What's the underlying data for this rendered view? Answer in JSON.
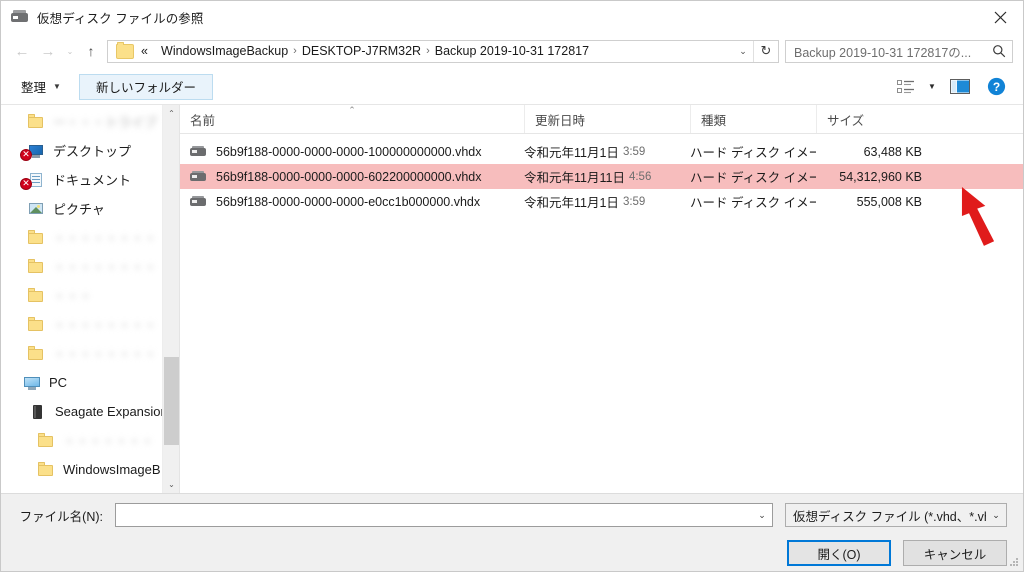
{
  "window": {
    "title": "仮想ディスク ファイルの参照",
    "title_icon": "hard-disk-icon",
    "close_label": "✕"
  },
  "nav": {
    "back_label": "←",
    "forward_label": "→",
    "history_caret": "⌄",
    "up_label": "↑",
    "breadcrumb_prefix": "«",
    "breadcrumbs": [
      "WindowsImageBackup",
      "DESKTOP-J7RM32R",
      "Backup 2019-10-31 172817"
    ],
    "separator": "›",
    "address_caret": "⌄",
    "refresh_label": "↻"
  },
  "search": {
    "placeholder": "Backup 2019-10-31 172817の...",
    "icon": "search-icon"
  },
  "toolbar": {
    "organize_label": "整理",
    "organize_caret": "▼",
    "new_folder_label": "新しいフォルダー",
    "view_caret": "▼",
    "view_icon": "list-view-icon",
    "preview_pane_icon": "preview-pane-icon",
    "help_icon": "help-icon",
    "help_label": "?"
  },
  "sidebar": {
    "items": [
      {
        "label": "ー・・・トライブ",
        "icon": "folder-icon",
        "blurred": true,
        "error": false
      },
      {
        "label": "デスクトップ",
        "icon": "desktop-icon",
        "blurred": false,
        "error": true
      },
      {
        "label": "ドキュメント",
        "icon": "document-icon",
        "blurred": false,
        "error": true
      },
      {
        "label": "ピクチャ",
        "icon": "picture-icon",
        "blurred": false,
        "error": false
      },
      {
        "label": "・・・・・・・・・・",
        "icon": "folder-icon",
        "blurred": true,
        "error": false
      },
      {
        "label": "・・・・・・・・・",
        "icon": "folder-icon",
        "blurred": true,
        "error": false
      },
      {
        "label": "・・・",
        "icon": "folder-icon",
        "blurred": true,
        "error": false
      },
      {
        "label": "・・・・・・・・",
        "icon": "folder-icon",
        "blurred": true,
        "error": false
      },
      {
        "label": "・・・・・・・・",
        "icon": "folder-icon",
        "blurred": true,
        "error": false
      },
      {
        "label": "PC",
        "icon": "pc-icon",
        "blurred": false,
        "error": false
      },
      {
        "label": "Seagate Expansion",
        "icon": "drive-icon",
        "blurred": false,
        "error": false
      },
      {
        "label": "・・・・・・・",
        "icon": "folder-icon",
        "blurred": true,
        "error": false
      },
      {
        "label": "WindowsImageB",
        "icon": "folder-icon",
        "blurred": false,
        "error": false
      }
    ],
    "scroll_up": "⌃",
    "scroll_down": "⌄"
  },
  "columns": {
    "name": "名前",
    "date": "更新日時",
    "type": "種類",
    "size": "サイズ",
    "sort_caret": "⌃"
  },
  "files": [
    {
      "name": "56b9f188-0000-0000-0000-100000000000.vhdx",
      "date": "令和元年11月1日",
      "time": "3:59",
      "type": "ハード ディスク イメー...",
      "size": "63,488 KB",
      "selected": false,
      "icon": "hard-disk-icon"
    },
    {
      "name": "56b9f188-0000-0000-0000-602200000000.vhdx",
      "date": "令和元年11月11日",
      "time": "4:56",
      "type": "ハード ディスク イメー...",
      "size": "54,312,960 KB",
      "selected": true,
      "icon": "hard-disk-icon"
    },
    {
      "name": "56b9f188-0000-0000-0000-e0cc1b000000.vhdx",
      "date": "令和元年11月1日",
      "time": "3:59",
      "type": "ハード ディスク イメー...",
      "size": "555,008 KB",
      "selected": false,
      "icon": "hard-disk-icon"
    }
  ],
  "bottom": {
    "filename_label": "ファイル名(N):",
    "filename_value": "",
    "filename_caret": "⌄",
    "filter_value": "仮想ディスク ファイル (*.vhd、*.vhc",
    "filter_caret": "⌄",
    "open_label": "開く(O)",
    "cancel_label": "キャンセル"
  },
  "annotation": {
    "arrow": "red-arrow",
    "color": "#e01b1b"
  },
  "colors": {
    "selection_row": "#f7bdbd",
    "accent": "#0078d7",
    "error_badge": "#d0021b"
  }
}
